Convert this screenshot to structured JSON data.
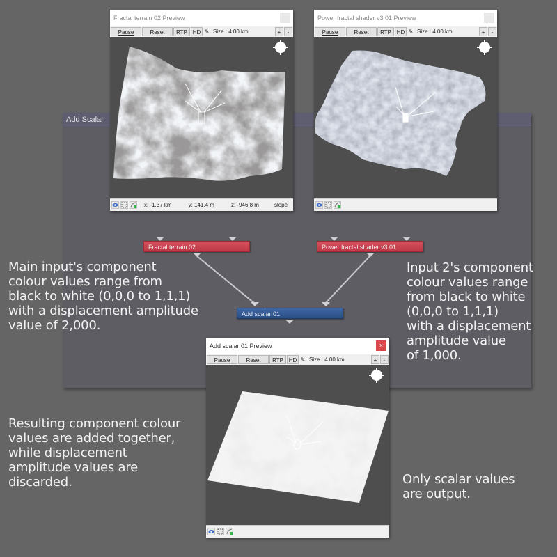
{
  "panel": {
    "title": "Add Scalar"
  },
  "previews": [
    {
      "title": "Fractal terrain 02 Preview",
      "active": false,
      "toolbar": {
        "pause": "Pause",
        "reset": "Reset",
        "rtp": "RTP",
        "hd": "HD",
        "size": "Size : 4.00 km",
        "plus": "+",
        "minus": "-"
      },
      "status": {
        "x": "x: -1.37 km",
        "y": "y: 141.4 m",
        "z": "z: -946.8 m",
        "slope": "slope"
      }
    },
    {
      "title": "Power fractal shader v3 01 Preview",
      "active": false,
      "toolbar": {
        "pause": "Pause",
        "reset": "Reset",
        "rtp": "RTP",
        "hd": "HD",
        "size": "Size : 4.00 km",
        "plus": "+",
        "minus": "-"
      },
      "status": {}
    },
    {
      "title": "Add scalar 01 Preview",
      "active": true,
      "close": "×",
      "toolbar": {
        "pause": "Pause",
        "reset": "Reset",
        "rtp": "RTP",
        "hd": "HD",
        "size": "Size : 4.00 km",
        "plus": "+",
        "minus": "-"
      },
      "status": {}
    }
  ],
  "nodes": {
    "fractal_terrain": {
      "label": "Fractal terrain 02",
      "color": "#c9404d"
    },
    "power_fractal": {
      "label": "Power fractal shader v3 01",
      "color": "#c9404d"
    },
    "add_scalar": {
      "label": "Add scalar 01",
      "color": "#345a94"
    }
  },
  "notes": {
    "main_input": [
      "Main input's component",
      "colour values range from",
      "black to white (0,0,0 to 1,1,1)",
      "with a displacement amplitude",
      "value of 2,000."
    ],
    "input2": [
      "Input 2's component",
      "colour values range",
      "from black to white",
      "(0,0,0 to 1,1,1)",
      "with a displacement",
      "amplitude value",
      "of 1,000."
    ],
    "result": [
      "Resulting component colour",
      "values are added together,",
      "while displacement",
      "amplitude values are",
      "discarded."
    ],
    "output": [
      "Only scalar values",
      "are output."
    ]
  },
  "icons": {
    "eye": "eye-icon",
    "frame": "frame-select-icon",
    "slope": "slope-icon",
    "brush": "brush-icon",
    "compass": "compass-icon"
  }
}
